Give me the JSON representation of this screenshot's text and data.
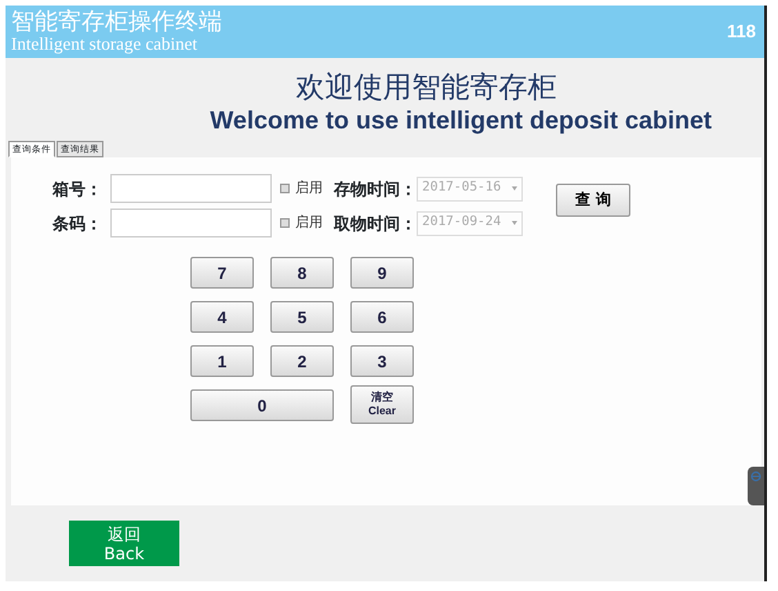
{
  "header": {
    "title": "智能寄存柜操作终端",
    "subtitle": "Intelligent storage cabinet",
    "number": "118"
  },
  "welcome": {
    "title": "欢迎使用智能寄存柜",
    "subtitle": "Welcome to use intelligent deposit cabinet"
  },
  "tabs": [
    {
      "label": "查询条件",
      "selected": true
    },
    {
      "label": "查询结果",
      "selected": false
    }
  ],
  "form_rows": [
    {
      "label": "箱号：",
      "value": "",
      "checkbox_label": "启用",
      "checked": false,
      "date_label": "存物时间：",
      "date": "2017-05-16"
    },
    {
      "label": "条码：",
      "value": "",
      "checkbox_label": "启用",
      "checked": false,
      "date_label": "取物时间：",
      "date": "2017-09-24"
    }
  ],
  "query_button": "查 询",
  "keypad": [
    "7",
    "8",
    "9",
    "4",
    "5",
    "6",
    "1",
    "2",
    "3",
    "0"
  ],
  "clear_key": [
    "清空",
    "Clear"
  ],
  "back_button": [
    "返回",
    "Back"
  ]
}
